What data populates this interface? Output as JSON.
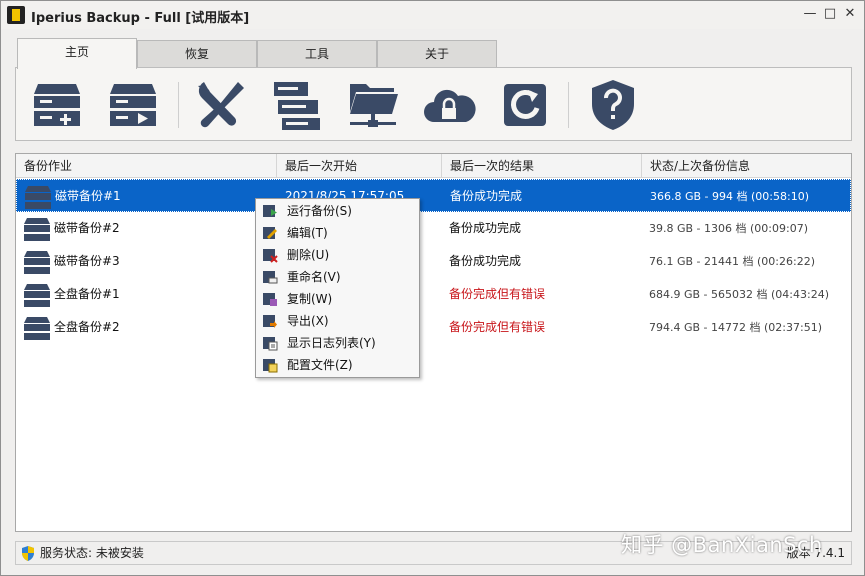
{
  "window": {
    "title": "Iperius Backup - Full [试用版本]"
  },
  "tabs": [
    {
      "label": "主页",
      "active": true
    },
    {
      "label": "恢复",
      "active": false
    },
    {
      "label": "工具",
      "active": false
    },
    {
      "label": "关于",
      "active": false
    }
  ],
  "ribbon": {
    "buttons": [
      {
        "icon": "drive-add-icon"
      },
      {
        "icon": "drive-run-icon"
      },
      {
        "icon": "tools-icon"
      },
      {
        "icon": "list-icon"
      },
      {
        "icon": "network-folder-icon"
      },
      {
        "icon": "cloud-lock-icon"
      },
      {
        "icon": "refresh-circle-icon"
      },
      {
        "icon": "help-shield-icon"
      }
    ],
    "icon_color": "#3a4a66"
  },
  "grid": {
    "columns": [
      "备份作业",
      "最后一次开始",
      "最后一次的结果",
      "状态/上次备份信息"
    ],
    "rows": [
      {
        "name": "磁带备份#1",
        "last_start": "2021/8/25 17:57:05",
        "result": "备份成功完成",
        "result_error": false,
        "info": "366.8 GB - 994 档 (00:58:10)",
        "selected": true
      },
      {
        "name": "磁带备份#2",
        "last_start": "",
        "result": "备份成功完成",
        "result_error": false,
        "info": "39.8 GB - 1306 档 (00:09:07)",
        "selected": false
      },
      {
        "name": "磁带备份#3",
        "last_start": "",
        "result": "备份成功完成",
        "result_error": false,
        "info": "76.1 GB - 21441 档 (00:26:22)",
        "selected": false
      },
      {
        "name": "全盘备份#1",
        "last_start": "",
        "result": "备份完成但有错误",
        "result_error": true,
        "info": "684.9 GB - 565032 档 (04:43:24)",
        "selected": false
      },
      {
        "name": "全盘备份#2",
        "last_start": "",
        "result": "备份完成但有错误",
        "result_error": true,
        "info": "794.4 GB - 14772 档 (02:37:51)",
        "selected": false
      }
    ],
    "selected_color": "#0a64c8",
    "error_color": "#c8151a"
  },
  "context_menu": {
    "items": [
      {
        "label": "运行备份(S)",
        "icon": "run-backup-icon"
      },
      {
        "label": "编辑(T)",
        "icon": "edit-icon"
      },
      {
        "label": "删除(U)",
        "icon": "delete-icon"
      },
      {
        "label": "重命名(V)",
        "icon": "rename-icon"
      },
      {
        "label": "复制(W)",
        "icon": "copy-icon"
      },
      {
        "label": "导出(X)",
        "icon": "export-icon"
      },
      {
        "label": "显示日志列表(Y)",
        "icon": "log-list-icon"
      },
      {
        "label": "配置文件(Z)",
        "icon": "config-file-icon"
      }
    ]
  },
  "statusbar": {
    "service_status": "服务状态: 未被安装",
    "version": "版本 7.4.1"
  },
  "watermark": "知乎 @BanXianSch"
}
